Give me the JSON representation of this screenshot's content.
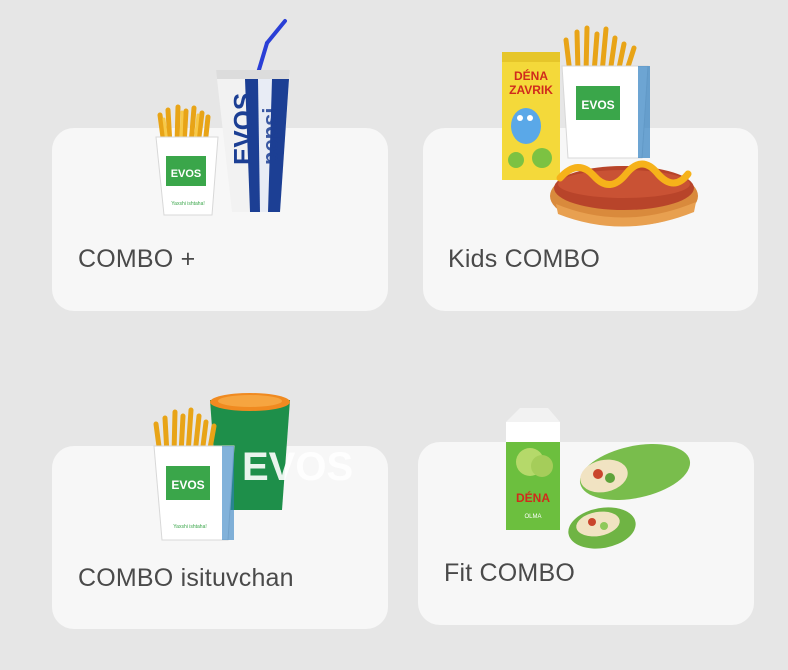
{
  "combos": [
    {
      "label": "COMBO +",
      "items": [
        "fries-icon",
        "pepsi-cup-icon"
      ],
      "brand": "EVOS",
      "cup_text": "pepsi"
    },
    {
      "label": "Kids COMBO",
      "items": [
        "juice-box-icon",
        "fries-icon",
        "hotdog-icon"
      ],
      "brand": "EVOS",
      "juice_brand": "DÉNA ZAVRIK"
    },
    {
      "label": "COMBO isituvchan",
      "items": [
        "fries-icon",
        "tea-cup-icon"
      ],
      "brand": "EVOS",
      "cup_text": "EVOS"
    },
    {
      "label": "Fit COMBO",
      "items": [
        "juice-carton-icon",
        "wrap-icon"
      ],
      "juice_brand": "DÉNA",
      "juice_flavor": "OLMA"
    }
  ],
  "colors": {
    "background": "#e6e6e6",
    "card": "#f7f7f7",
    "label": "#4a4a4a",
    "brand_green": "#3aa64a",
    "pepsi_blue": "#1c3f94"
  }
}
